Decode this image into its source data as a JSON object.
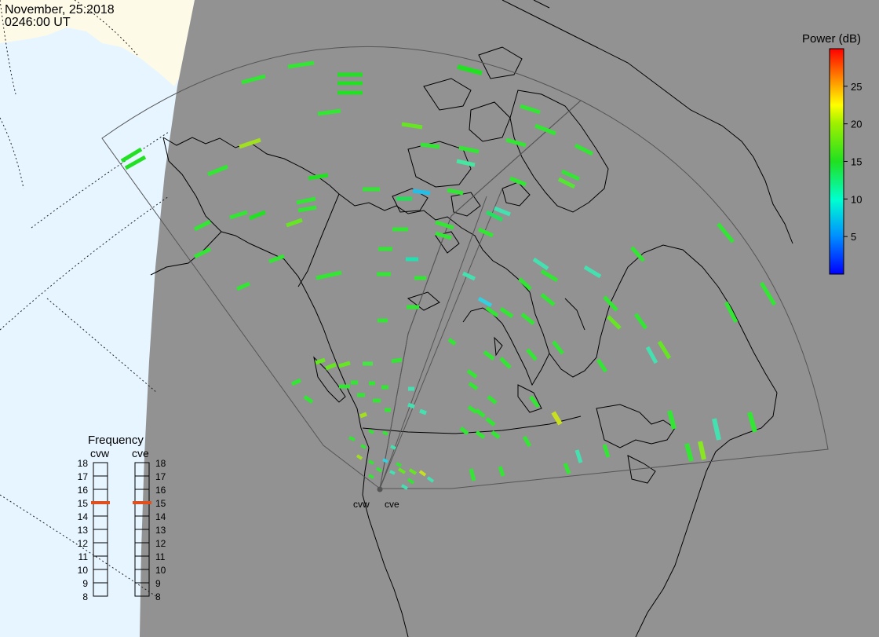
{
  "header": {
    "date": "November, 25.2018",
    "time": "0246:00 UT"
  },
  "colorbar": {
    "title": "Power (dB)",
    "ticks": [
      "25",
      "20",
      "15",
      "10",
      "5"
    ],
    "tick_values": [
      25,
      20,
      15,
      10,
      5
    ],
    "range": [
      0,
      30
    ]
  },
  "radars": [
    {
      "code": "cvw",
      "label": "cvw"
    },
    {
      "code": "cve",
      "label": "cve"
    }
  ],
  "frequency_panel": {
    "title": "Frequency",
    "cvw_label": "cvw",
    "cve_label": "cve",
    "ticks": [
      "18",
      "17",
      "16",
      "15",
      "14",
      "13",
      "12",
      "11",
      "10",
      "9",
      "8"
    ],
    "cvw_frequency": 15,
    "cve_frequency": 15,
    "indicator_color": "#e0501e"
  },
  "colors": {
    "night": "#929292",
    "day_ocean": "#e6f5ff",
    "day_land": "#fdfbe8",
    "coastline": "#000000",
    "fov_border": "#555555"
  }
}
